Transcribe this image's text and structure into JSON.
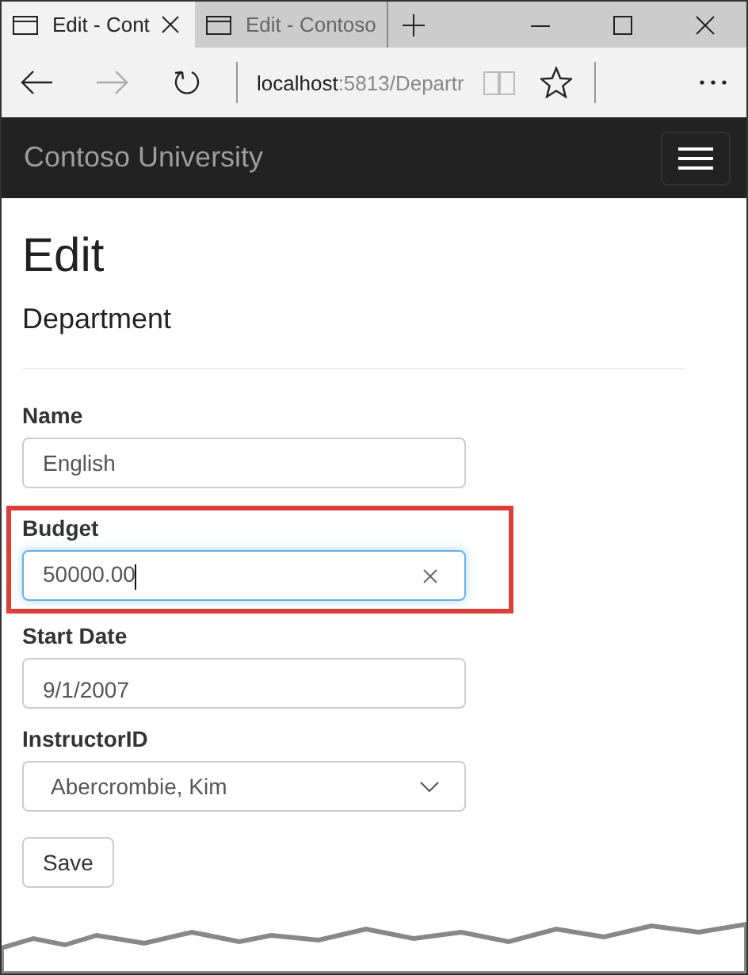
{
  "browser": {
    "tabs": [
      {
        "title": "Edit - Cont",
        "selected": true
      },
      {
        "title": "Edit - Contoso",
        "selected": false
      }
    ],
    "address": {
      "host": "localhost",
      "path": ":5813/Departr"
    }
  },
  "navbar": {
    "brand": "Contoso University"
  },
  "page": {
    "title": "Edit",
    "subtitle": "Department"
  },
  "fields": [
    {
      "kind": "text",
      "label": "Name",
      "value": "English",
      "focused": false,
      "highlighted": false
    },
    {
      "kind": "text",
      "label": "Budget",
      "value": "50000.00",
      "focused": true,
      "highlighted": true
    },
    {
      "kind": "date",
      "label": "Start Date",
      "value": "9/1/2007",
      "focused": false,
      "highlighted": false
    },
    {
      "kind": "select",
      "label": "InstructorID",
      "value": "Abercrombie, Kim",
      "focused": false,
      "highlighted": false
    }
  ],
  "save_button": "Save"
}
